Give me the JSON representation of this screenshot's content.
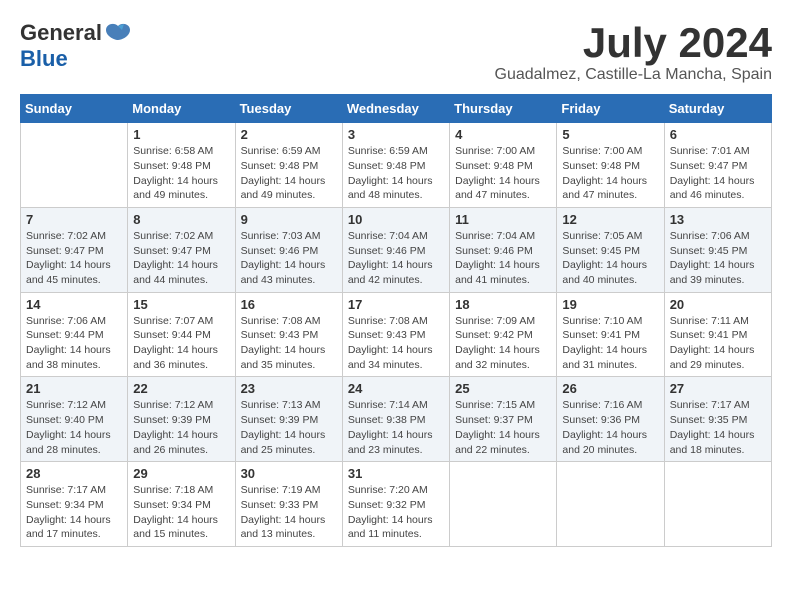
{
  "header": {
    "logo_general": "General",
    "logo_blue": "Blue",
    "month_year": "July 2024",
    "location": "Guadalmez, Castille-La Mancha, Spain"
  },
  "weekdays": [
    "Sunday",
    "Monday",
    "Tuesday",
    "Wednesday",
    "Thursday",
    "Friday",
    "Saturday"
  ],
  "weeks": [
    [
      {
        "day": "",
        "info": ""
      },
      {
        "day": "1",
        "info": "Sunrise: 6:58 AM\nSunset: 9:48 PM\nDaylight: 14 hours\nand 49 minutes."
      },
      {
        "day": "2",
        "info": "Sunrise: 6:59 AM\nSunset: 9:48 PM\nDaylight: 14 hours\nand 49 minutes."
      },
      {
        "day": "3",
        "info": "Sunrise: 6:59 AM\nSunset: 9:48 PM\nDaylight: 14 hours\nand 48 minutes."
      },
      {
        "day": "4",
        "info": "Sunrise: 7:00 AM\nSunset: 9:48 PM\nDaylight: 14 hours\nand 47 minutes."
      },
      {
        "day": "5",
        "info": "Sunrise: 7:00 AM\nSunset: 9:48 PM\nDaylight: 14 hours\nand 47 minutes."
      },
      {
        "day": "6",
        "info": "Sunrise: 7:01 AM\nSunset: 9:47 PM\nDaylight: 14 hours\nand 46 minutes."
      }
    ],
    [
      {
        "day": "7",
        "info": "Sunrise: 7:02 AM\nSunset: 9:47 PM\nDaylight: 14 hours\nand 45 minutes."
      },
      {
        "day": "8",
        "info": "Sunrise: 7:02 AM\nSunset: 9:47 PM\nDaylight: 14 hours\nand 44 minutes."
      },
      {
        "day": "9",
        "info": "Sunrise: 7:03 AM\nSunset: 9:46 PM\nDaylight: 14 hours\nand 43 minutes."
      },
      {
        "day": "10",
        "info": "Sunrise: 7:04 AM\nSunset: 9:46 PM\nDaylight: 14 hours\nand 42 minutes."
      },
      {
        "day": "11",
        "info": "Sunrise: 7:04 AM\nSunset: 9:46 PM\nDaylight: 14 hours\nand 41 minutes."
      },
      {
        "day": "12",
        "info": "Sunrise: 7:05 AM\nSunset: 9:45 PM\nDaylight: 14 hours\nand 40 minutes."
      },
      {
        "day": "13",
        "info": "Sunrise: 7:06 AM\nSunset: 9:45 PM\nDaylight: 14 hours\nand 39 minutes."
      }
    ],
    [
      {
        "day": "14",
        "info": "Sunrise: 7:06 AM\nSunset: 9:44 PM\nDaylight: 14 hours\nand 38 minutes."
      },
      {
        "day": "15",
        "info": "Sunrise: 7:07 AM\nSunset: 9:44 PM\nDaylight: 14 hours\nand 36 minutes."
      },
      {
        "day": "16",
        "info": "Sunrise: 7:08 AM\nSunset: 9:43 PM\nDaylight: 14 hours\nand 35 minutes."
      },
      {
        "day": "17",
        "info": "Sunrise: 7:08 AM\nSunset: 9:43 PM\nDaylight: 14 hours\nand 34 minutes."
      },
      {
        "day": "18",
        "info": "Sunrise: 7:09 AM\nSunset: 9:42 PM\nDaylight: 14 hours\nand 32 minutes."
      },
      {
        "day": "19",
        "info": "Sunrise: 7:10 AM\nSunset: 9:41 PM\nDaylight: 14 hours\nand 31 minutes."
      },
      {
        "day": "20",
        "info": "Sunrise: 7:11 AM\nSunset: 9:41 PM\nDaylight: 14 hours\nand 29 minutes."
      }
    ],
    [
      {
        "day": "21",
        "info": "Sunrise: 7:12 AM\nSunset: 9:40 PM\nDaylight: 14 hours\nand 28 minutes."
      },
      {
        "day": "22",
        "info": "Sunrise: 7:12 AM\nSunset: 9:39 PM\nDaylight: 14 hours\nand 26 minutes."
      },
      {
        "day": "23",
        "info": "Sunrise: 7:13 AM\nSunset: 9:39 PM\nDaylight: 14 hours\nand 25 minutes."
      },
      {
        "day": "24",
        "info": "Sunrise: 7:14 AM\nSunset: 9:38 PM\nDaylight: 14 hours\nand 23 minutes."
      },
      {
        "day": "25",
        "info": "Sunrise: 7:15 AM\nSunset: 9:37 PM\nDaylight: 14 hours\nand 22 minutes."
      },
      {
        "day": "26",
        "info": "Sunrise: 7:16 AM\nSunset: 9:36 PM\nDaylight: 14 hours\nand 20 minutes."
      },
      {
        "day": "27",
        "info": "Sunrise: 7:17 AM\nSunset: 9:35 PM\nDaylight: 14 hours\nand 18 minutes."
      }
    ],
    [
      {
        "day": "28",
        "info": "Sunrise: 7:17 AM\nSunset: 9:34 PM\nDaylight: 14 hours\nand 17 minutes."
      },
      {
        "day": "29",
        "info": "Sunrise: 7:18 AM\nSunset: 9:34 PM\nDaylight: 14 hours\nand 15 minutes."
      },
      {
        "day": "30",
        "info": "Sunrise: 7:19 AM\nSunset: 9:33 PM\nDaylight: 14 hours\nand 13 minutes."
      },
      {
        "day": "31",
        "info": "Sunrise: 7:20 AM\nSunset: 9:32 PM\nDaylight: 14 hours\nand 11 minutes."
      },
      {
        "day": "",
        "info": ""
      },
      {
        "day": "",
        "info": ""
      },
      {
        "day": "",
        "info": ""
      }
    ]
  ]
}
